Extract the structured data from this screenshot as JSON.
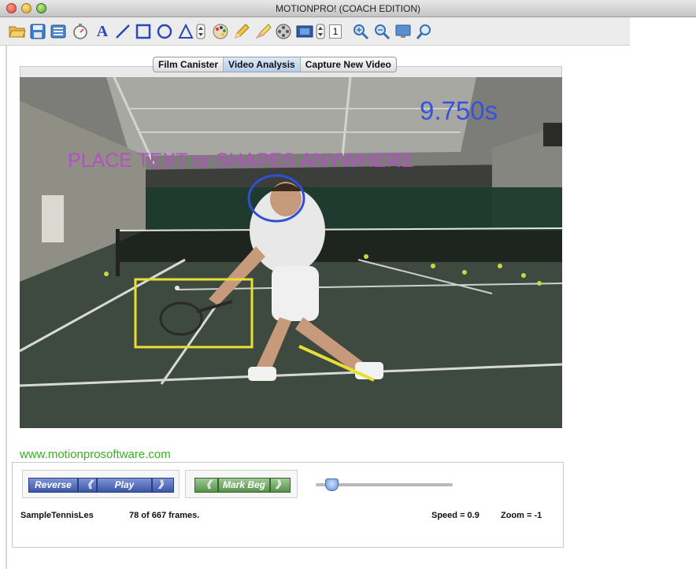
{
  "window": {
    "title": "MOTIONPRO! (COACH EDITION)"
  },
  "toolbar": {
    "items": [
      {
        "icon": "folder-open-icon"
      },
      {
        "icon": "save-disk-icon"
      },
      {
        "icon": "list-icon"
      },
      {
        "icon": "stopwatch-icon"
      },
      {
        "icon": "text-tool-icon",
        "label": "A"
      },
      {
        "icon": "line-tool-icon"
      },
      {
        "icon": "rectangle-tool-icon"
      },
      {
        "icon": "circle-tool-icon"
      },
      {
        "icon": "triangle-tool-icon"
      },
      {
        "icon": "size-stepper-icon"
      },
      {
        "icon": "color-palette-icon"
      },
      {
        "icon": "pencil-icon"
      },
      {
        "icon": "eraser-icon"
      },
      {
        "icon": "film-reel-icon"
      },
      {
        "icon": "film-strip-icon"
      },
      {
        "icon": "frame-stepper-icon"
      },
      {
        "icon": "frame-step-value",
        "label": "1"
      },
      {
        "icon": "zoom-in-icon"
      },
      {
        "icon": "zoom-out-icon"
      },
      {
        "icon": "monitor-icon"
      },
      {
        "icon": "magnifier-icon"
      }
    ]
  },
  "tabs": [
    {
      "label": "Film Canister",
      "active": false
    },
    {
      "label": "Video Analysis",
      "active": true
    },
    {
      "label": "Capture New Video",
      "active": false
    }
  ],
  "video": {
    "overlay_text": "PLACE TEXT or SHAPES ANYWHERE",
    "timer": "9.750s",
    "overlay_text_color": "#b44fc4",
    "timer_color": "#3552e0",
    "circle_color": "#2f4fd8",
    "box_color": "#e8e030",
    "line_color": "#e8e030"
  },
  "website": "www.motionprosoftware.com",
  "controls": {
    "reverse_label": "Reverse",
    "rewind_label": "《",
    "play_label": "Play",
    "forward_label": "》",
    "mark_prev_label": "《",
    "mark_beg_label": "Mark Beg",
    "mark_next_label": "》",
    "clip_name": "SampleTennisLes",
    "frames_status": "78 of 667 frames.",
    "speed": "Speed = 0.9",
    "zoom": "Zoom =  -1",
    "playhead_fraction": 0.12
  },
  "colors": {
    "website_green": "#39b020",
    "button_blue": "#3c56a8",
    "button_green": "#57924b"
  }
}
